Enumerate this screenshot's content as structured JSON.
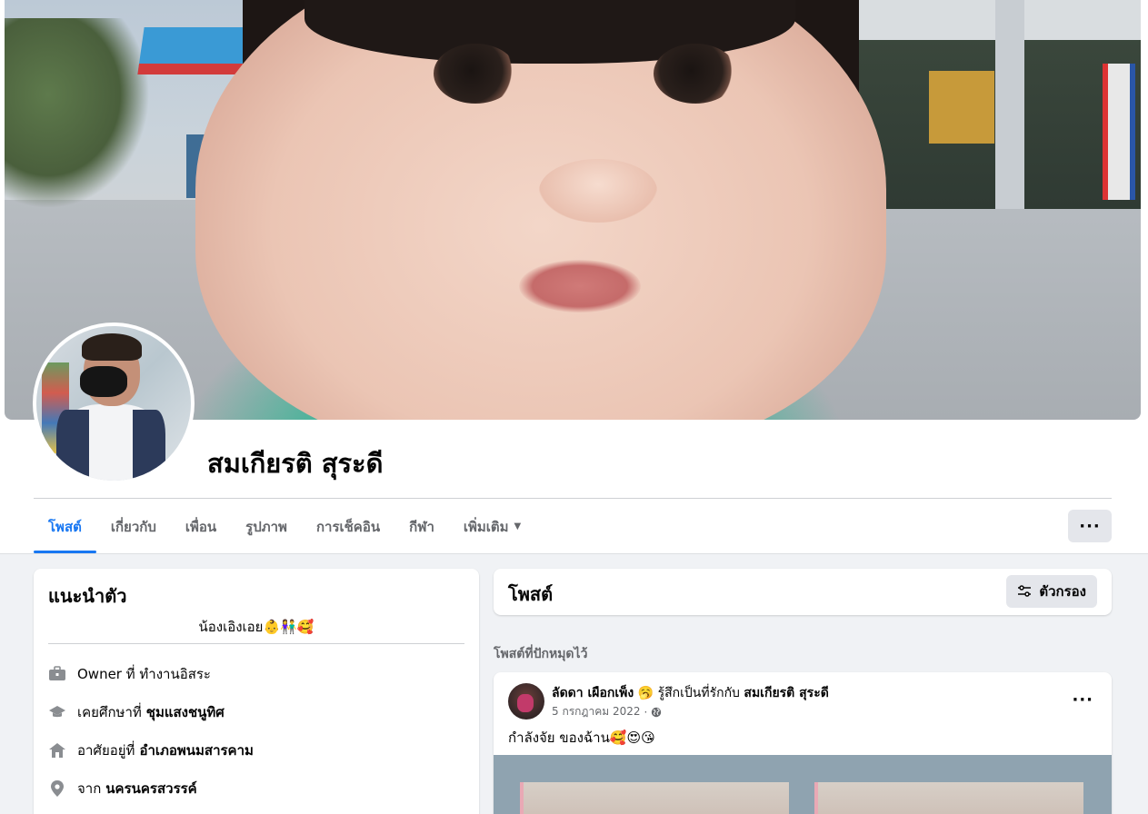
{
  "profile": {
    "name": "สมเกียรติ สุระดี"
  },
  "tabs": [
    {
      "label": "โพสต์",
      "active": true
    },
    {
      "label": "เกี่ยวกับ",
      "active": false
    },
    {
      "label": "เพื่อน",
      "active": false
    },
    {
      "label": "รูปภาพ",
      "active": false
    },
    {
      "label": "การเช็คอิน",
      "active": false
    },
    {
      "label": "กีฬา",
      "active": false
    },
    {
      "label": "เพิ่มเติม",
      "active": false
    }
  ],
  "more_button": "···",
  "intro": {
    "title": "แนะนำตัว",
    "bio": "น้องเอิงเอย👶👫🥰",
    "rows": [
      {
        "icon": "briefcase-icon",
        "prefix": "Owner ที่ ทำงานอิสระ",
        "bold": ""
      },
      {
        "icon": "graduation-cap-icon",
        "prefix": "เคยศึกษาที่",
        "bold": "ชุมแสงชนูทิศ"
      },
      {
        "icon": "home-icon",
        "prefix": "อาศัยอยู่ที่",
        "bold": "อำเภอพนมสารคาม"
      },
      {
        "icon": "location-pin-icon",
        "prefix": "จาก",
        "bold": "นครนครสวรรค์"
      }
    ]
  },
  "posts_card": {
    "title": "โพสต์",
    "filter_label": "ตัวกรอง"
  },
  "pinned_label": "โพสต์ที่ปักหมุดไว้",
  "post": {
    "author": "ลัดดา เผือกเพ็ง",
    "feeling": "🥱 รู้สึกเป็นที่รักกับ",
    "tagged": "สมเกียรติ สุระดี",
    "date": "5 กรกฎาคม 2022",
    "dot": "·",
    "text": "กำลังจัย ของฉ้าน🥰😍😘",
    "more": "···"
  },
  "colors": {
    "accent": "#1877f2",
    "page_bg": "#f0f2f5",
    "secondary_text": "#65676b",
    "button_bg": "#e4e6eb"
  }
}
